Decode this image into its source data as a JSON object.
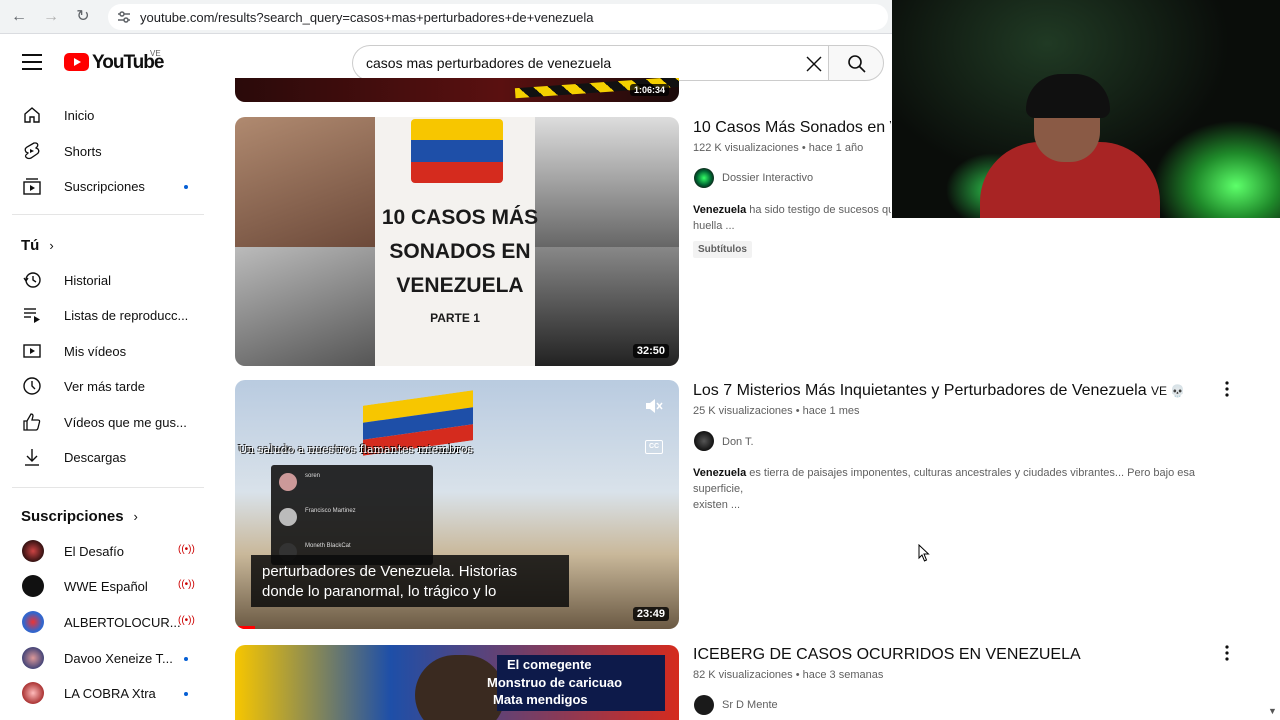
{
  "browser": {
    "url": "youtube.com/results?search_query=casos+mas+perturbadores+de+venezuela"
  },
  "masthead": {
    "logo_text": "YouTube",
    "country_code": "VE",
    "search_value": "casos mas perturbadores de venezuela"
  },
  "sidebar": {
    "main": [
      {
        "label": "Inicio",
        "icon": "home-icon"
      },
      {
        "label": "Shorts",
        "icon": "shorts-icon"
      },
      {
        "label": "Suscripciones",
        "icon": "subscriptions-icon"
      }
    ],
    "you_heading": "Tú",
    "you_items": [
      {
        "label": "Historial",
        "icon": "history-icon"
      },
      {
        "label": "Listas de reproducc...",
        "icon": "playlists-icon"
      },
      {
        "label": "Mis vídeos",
        "icon": "your-videos-icon"
      },
      {
        "label": "Ver más tarde",
        "icon": "watch-later-icon"
      },
      {
        "label": "Vídeos que me gus...",
        "icon": "liked-icon"
      },
      {
        "label": "Descargas",
        "icon": "download-icon"
      }
    ],
    "subs_heading": "Suscripciones",
    "subs": [
      {
        "label": "El Desafío",
        "status": "live"
      },
      {
        "label": "WWE Español",
        "status": "live"
      },
      {
        "label": "ALBERTOLOCUR...",
        "status": "live"
      },
      {
        "label": "Davoo Xeneize T...",
        "status": "new"
      },
      {
        "label": "LA COBRA Xtra",
        "status": "new"
      }
    ]
  },
  "results": [
    {
      "title": "10 Casos Más Sonados en V",
      "views": "122 K visualizaciones",
      "age": "hace 1 año",
      "channel": "Dossier Interactivo",
      "desc_bold": "Venezuela",
      "desc_rest": " ha sido testigo de sucesos que",
      "desc_line2": "huella ...",
      "badge": "Subtítulos",
      "duration": "32:50",
      "thumb_text": [
        "10 CASOS MÁS",
        "SONADOS EN",
        "VENEZUELA"
      ],
      "thumb_sub": "PARTE 1"
    },
    {
      "title": "Los 7 Misterios Más Inquietantes y Perturbadores de Venezuela",
      "title_suffix": "VE 💀",
      "views": "25 K visualizaciones",
      "age": "hace 1 mes",
      "channel": "Don T.",
      "desc_bold": "Venezuela",
      "desc_rest": " es tierra de paisajes imponentes, culturas ancestrales y ciudades vibrantes... Pero bajo esa superficie,",
      "desc_line2": "existen ...",
      "duration": "23:49",
      "thumb_caption_top": "Un saludo a nuestros flamantes miembros",
      "thumb_caption_1": "perturbadores de Venezuela. Historias",
      "thumb_caption_2": "donde lo paranormal, lo trágico y lo",
      "members": [
        "soren",
        "Francisco Martinez",
        "Moneth BlackCat"
      ]
    },
    {
      "title": "ICEBERG DE CASOS OCURRIDOS EN VENEZUELA",
      "views": "82 K visualizaciones",
      "age": "hace 3 semanas",
      "channel": "Sr D Mente",
      "thumb_text": [
        "El comegente",
        "Monstruo de caricuao",
        "Mata mendigos"
      ]
    }
  ],
  "top_thumb_duration": "1:06:34",
  "colors": {
    "accent": "#065fd4",
    "brand": "#ff0000",
    "live": "#cc0000"
  }
}
